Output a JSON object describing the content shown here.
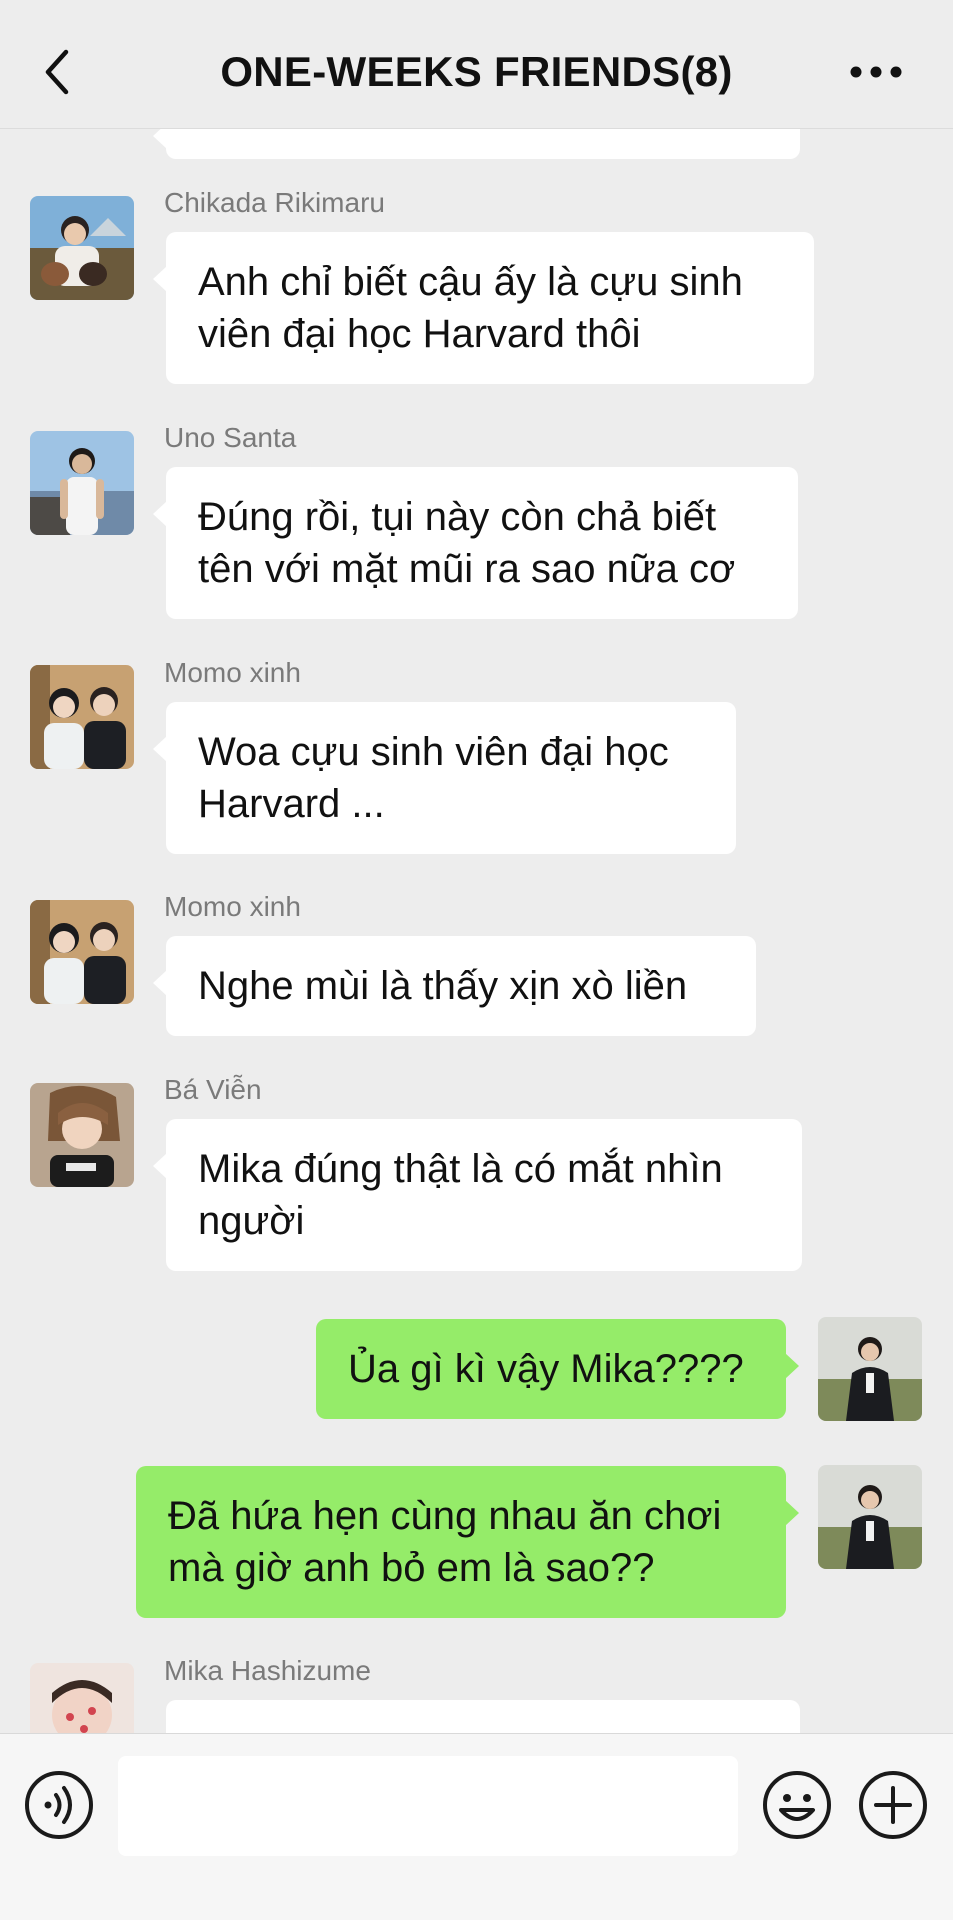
{
  "header": {
    "title": "ONE-WEEKS FRIENDS(8)",
    "back_icon": "chevron-left-icon",
    "more_icon": "more-dots-icon"
  },
  "messages": [
    {
      "side": "left",
      "sender": "Chikada Rikimaru",
      "text": "Anh chỉ biết cậu ấy là cựu sinh viên đại học Harvard thôi"
    },
    {
      "side": "left",
      "sender": "Uno Santa",
      "text": "Đúng rồi, tụi này còn chả biết tên với mặt mũi ra sao nữa cơ"
    },
    {
      "side": "left",
      "sender": "Momo xinh",
      "text": "Woa cựu sinh viên đại học Harvard ..."
    },
    {
      "side": "left",
      "sender": "Momo xinh",
      "text": "Nghe mùi là thấy xịn xò liền"
    },
    {
      "side": "left",
      "sender": "Bá Viễn",
      "text": "Mika đúng thật là có mắt nhìn người"
    },
    {
      "side": "right",
      "text": "Ủa gì kì vậy Mika????"
    },
    {
      "side": "right",
      "text": "Đã hứa hẹn cùng nhau ăn chơi mà giờ anh bỏ em là sao??"
    },
    {
      "side": "left",
      "sender": "Mika Hashizume",
      "text": ""
    }
  ],
  "input_bar": {
    "voice_icon": "voice-icon",
    "emoji_icon": "emoji-icon",
    "plus_icon": "plus-icon",
    "input_value": ""
  },
  "colors": {
    "background": "#ededed",
    "bubble_incoming": "#ffffff",
    "bubble_outgoing": "#95ec69",
    "sender_name": "#7a7a7a"
  }
}
